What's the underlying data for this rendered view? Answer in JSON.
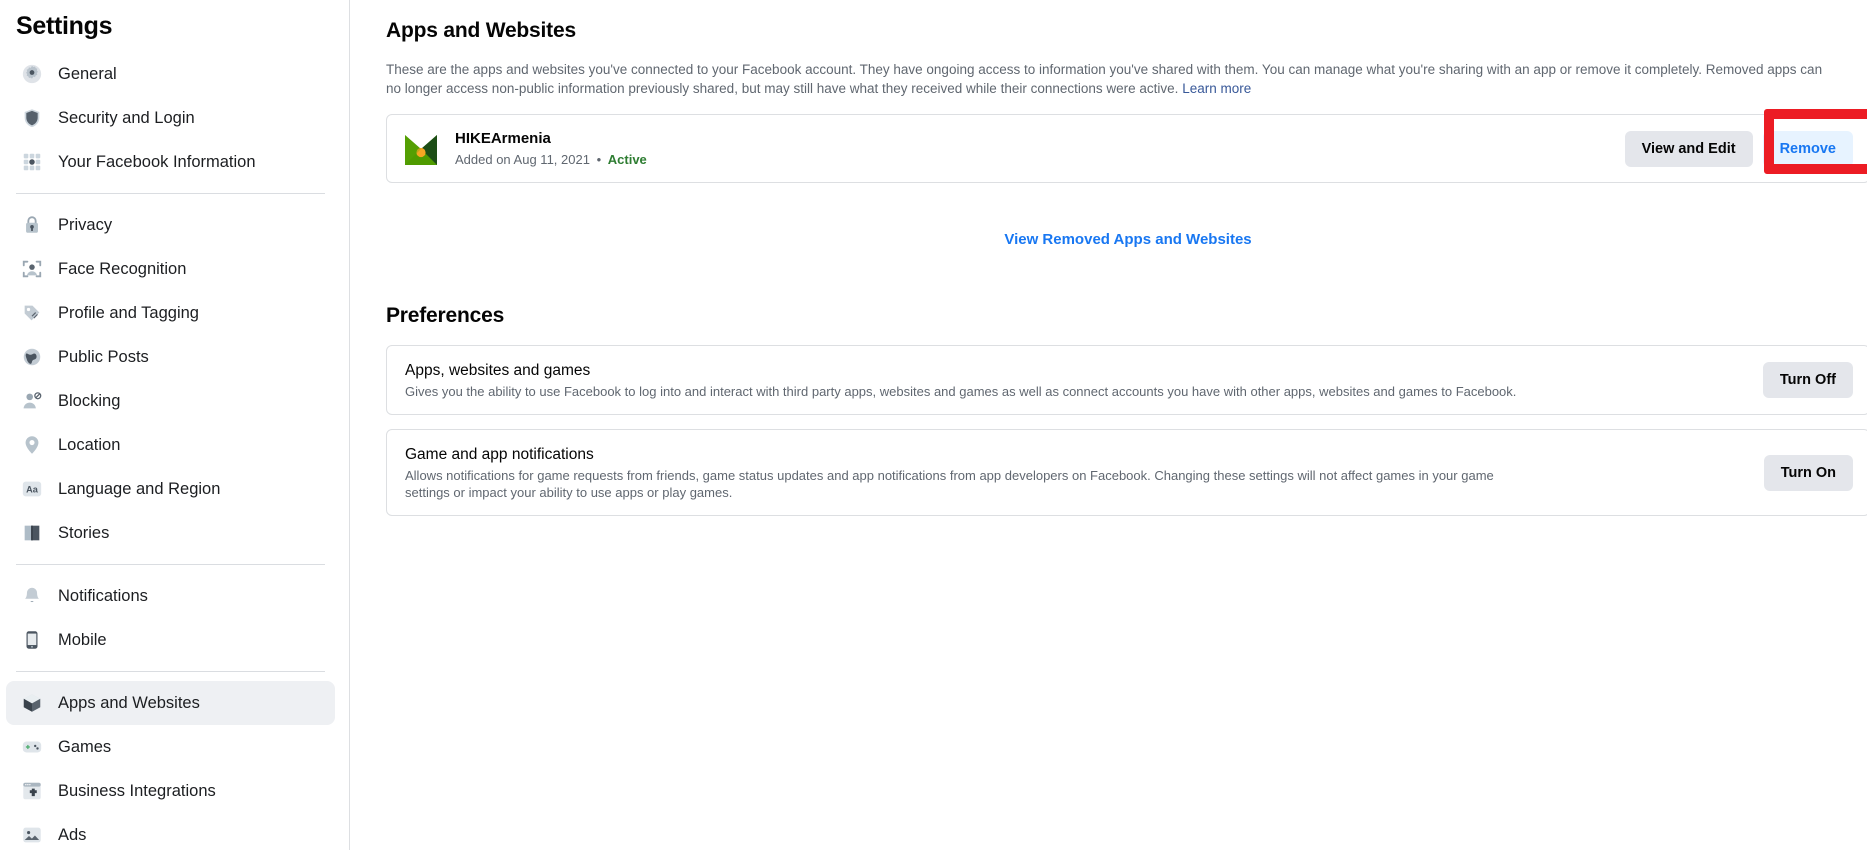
{
  "sidebar": {
    "title": "Settings",
    "groups": [
      {
        "items": [
          {
            "label": "General",
            "icon": "gear-icon",
            "active": false
          },
          {
            "label": "Security and Login",
            "icon": "shield-icon",
            "active": false
          },
          {
            "label": "Your Facebook Information",
            "icon": "grid-dots-icon",
            "active": false
          }
        ]
      },
      {
        "items": [
          {
            "label": "Privacy",
            "icon": "lock-icon",
            "active": false
          },
          {
            "label": "Face Recognition",
            "icon": "face-scan-icon",
            "active": false
          },
          {
            "label": "Profile and Tagging",
            "icon": "tag-icon",
            "active": false
          },
          {
            "label": "Public Posts",
            "icon": "globe-icon",
            "active": false
          },
          {
            "label": "Blocking",
            "icon": "person-block-icon",
            "active": false
          },
          {
            "label": "Location",
            "icon": "map-pin-icon",
            "active": false
          },
          {
            "label": "Language and Region",
            "icon": "language-aa-icon",
            "active": false
          },
          {
            "label": "Stories",
            "icon": "book-icon",
            "active": false
          }
        ]
      },
      {
        "items": [
          {
            "label": "Notifications",
            "icon": "bell-icon",
            "active": false
          },
          {
            "label": "Mobile",
            "icon": "phone-icon",
            "active": false
          }
        ]
      },
      {
        "items": [
          {
            "label": "Apps and Websites",
            "icon": "cube-icon",
            "active": true
          },
          {
            "label": "Games",
            "icon": "gamepad-icon",
            "active": false
          },
          {
            "label": "Business Integrations",
            "icon": "business-window-icon",
            "active": false
          },
          {
            "label": "Ads",
            "icon": "image-ad-icon",
            "active": false
          }
        ]
      }
    ]
  },
  "main": {
    "heading": "Apps and Websites",
    "intro": {
      "text": "These are the apps and websites you've connected to your Facebook account. They have ongoing access to information you've shared with them. You can manage what you're sharing with an app or remove it completely. Removed apps can no longer access non-public information previously shared, but may still have what they received while their connections were active.",
      "link_label": "Learn more"
    },
    "apps": [
      {
        "name": "HIKEArmenia",
        "meta_prefix": "Added on Aug 11, 2021",
        "meta_separator": "•",
        "status": "Active",
        "logo": "hike-armenia-mountain-logo",
        "view_edit_label": "View and Edit",
        "remove_label": "Remove",
        "remove_highlighted": true
      }
    ],
    "view_removed_label": "View Removed Apps and Websites",
    "preferences": {
      "title": "Preferences",
      "items": [
        {
          "heading": "Apps, websites and games",
          "description": "Gives you the ability to use Facebook to log into and interact with third party apps, websites and games as well as connect accounts you have with other apps, websites and games to Facebook.",
          "button_label": "Turn Off"
        },
        {
          "heading": "Game and app notifications",
          "description": "Allows notifications for game requests from friends, game status updates and app notifications from app developers on Facebook. Changing these settings will not affect games in your game settings or impact your ability to use apps or play games.",
          "button_label": "Turn On"
        }
      ]
    }
  },
  "colors": {
    "accent_blue": "#1877f2",
    "link_blue": "#385898",
    "ghost_blue_bg": "#e7f3ff",
    "secondary_bg": "#e4e6eb",
    "status_green": "#2e7d32",
    "annotation_red": "#ec1c24",
    "active_nav_bg": "#eef0f3"
  }
}
